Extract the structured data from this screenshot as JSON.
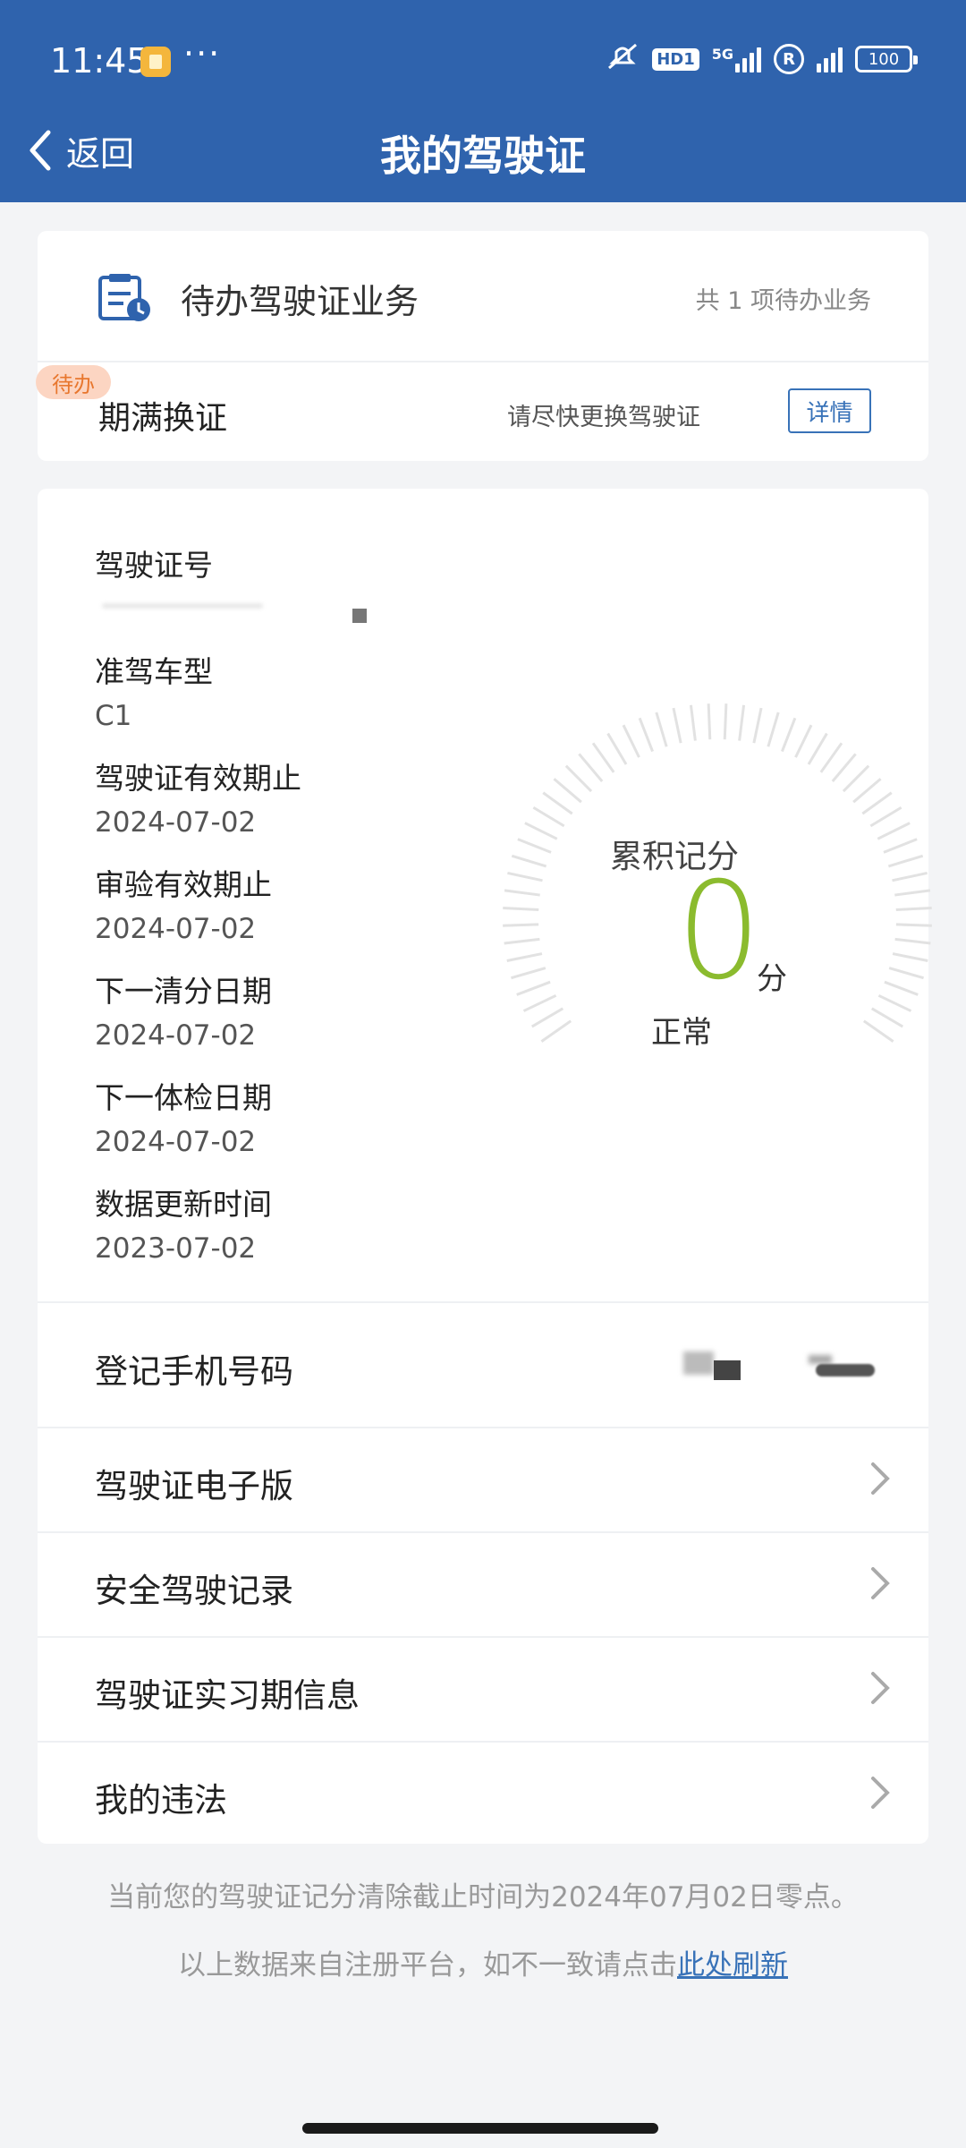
{
  "status_bar": {
    "time": "11:45",
    "more": "···",
    "hd_badge": "HD1",
    "network": "5G",
    "r_badge": "R",
    "battery": "100"
  },
  "header": {
    "back_label": "返回",
    "title": "我的驾驶证"
  },
  "todo": {
    "title": "待办驾驶证业务",
    "count_text": "共 1 项待办业务",
    "badge": "待办",
    "item_name": "期满换证",
    "item_desc": "请尽快更换驾驶证",
    "detail_label": "详情"
  },
  "license_info": {
    "items": [
      {
        "label": "驾驶证号",
        "value": ""
      },
      {
        "label": "准驾车型",
        "value": "C1"
      },
      {
        "label": "驾驶证有效期止",
        "value": "2024-07-02"
      },
      {
        "label": "审验有效期止",
        "value": "2024-07-02"
      },
      {
        "label": "下一清分日期",
        "value": "2024-07-02"
      },
      {
        "label": "下一体检日期",
        "value": "2024-07-02"
      },
      {
        "label": "数据更新时间",
        "value": "2023-07-02"
      }
    ]
  },
  "score": {
    "title": "累积记分",
    "value": "0",
    "unit": "分",
    "status": "正常",
    "accent_color": "#8bbb2e"
  },
  "phone": {
    "label": "登记手机号码"
  },
  "menu": [
    {
      "label": "驾驶证电子版",
      "icon": "chevron-right-icon"
    },
    {
      "label": "安全驾驶记录",
      "icon": "chevron-right-icon"
    },
    {
      "label": "驾驶证实习期信息",
      "icon": "chevron-right-icon"
    },
    {
      "label": "我的违法",
      "icon": "chevron-right-icon"
    }
  ],
  "footer": {
    "note1": "当前您的驾驶证记分清除截止时间为2024年07月02日零点。",
    "note2_prefix": "以上数据来自注册平台，如不一致请点击",
    "note2_link": "此处刷新"
  },
  "colors": {
    "header_bg": "#2f63ad",
    "link": "#3872b8",
    "badge_bg": "#fcd5c2",
    "badge_text": "#e8772e"
  }
}
